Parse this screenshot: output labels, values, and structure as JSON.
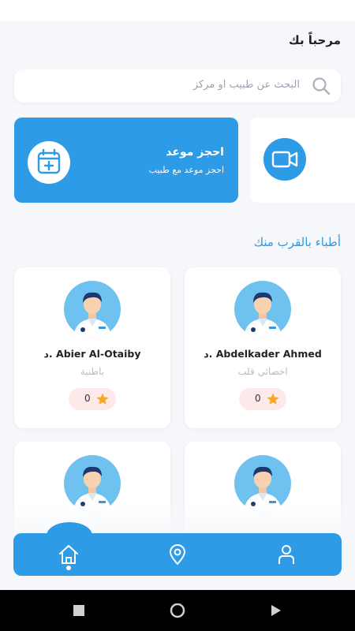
{
  "header": {
    "greeting": "مرحباً بك"
  },
  "search": {
    "placeholder": "البحث عن طبيب او مركز"
  },
  "book_card": {
    "title": "احجز موعد",
    "subtitle": "احجز موعد مع طبيب"
  },
  "nearby": {
    "title": "أطباء بالقرب منك"
  },
  "doctors": [
    {
      "name": "Abdelkader Ahmed .د",
      "specialty": "اخصائي قلب",
      "rating": "0"
    },
    {
      "name": "Abier Al-Otaiby .د",
      "specialty": "باطنية",
      "rating": "0"
    }
  ],
  "colors": {
    "primary": "#2e9be6",
    "star": "#f5a623",
    "rating_bg": "#fde8ea"
  },
  "icons": {
    "search": "search-icon",
    "calendar": "calendar-icon",
    "video": "video-camera-icon",
    "star": "star-icon",
    "home": "home-icon",
    "location": "location-pin-icon",
    "profile": "user-icon"
  }
}
